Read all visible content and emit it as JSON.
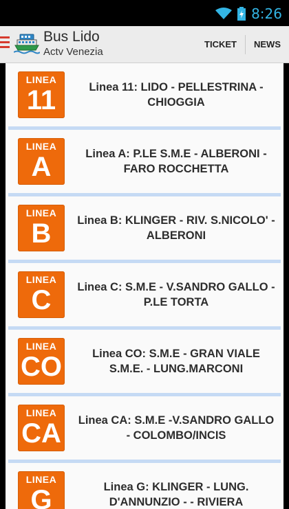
{
  "status_bar": {
    "time": "8:26"
  },
  "action_bar": {
    "title": "Bus Lido",
    "subtitle": "Actv Venezia",
    "actions": [
      "TICKET",
      "NEWS"
    ]
  },
  "lines": [
    {
      "badge_top": "LINEA",
      "badge_code": "11",
      "label": "Linea 11: LIDO - PELLESTRINA - CHIOGGIA"
    },
    {
      "badge_top": "LINEA",
      "badge_code": "A",
      "label": "Linea A: P.LE S.M.E - ALBERONI - FARO ROCCHETTA"
    },
    {
      "badge_top": "LINEA",
      "badge_code": "B",
      "label": "Linea B: KLINGER - RIV. S.NICOLO' - ALBERONI"
    },
    {
      "badge_top": "LINEA",
      "badge_code": "C",
      "label": "Linea C: S.M.E - V.SANDRO GALLO - P.LE TORTA"
    },
    {
      "badge_top": "LINEA",
      "badge_code": "CO",
      "label": "Linea CO: S.M.E - GRAN VIALE S.M.E. - LUNG.MARCONI"
    },
    {
      "badge_top": "LINEA",
      "badge_code": "CA",
      "label": "Linea CA: S.M.E -V.SANDRO GALLO - COLOMBO/INCIS"
    },
    {
      "badge_top": "LINEA",
      "badge_code": "G",
      "label": "Linea G: KLINGER - LUNG. D'ANNUNZIO -  - RIVIERA"
    }
  ]
}
